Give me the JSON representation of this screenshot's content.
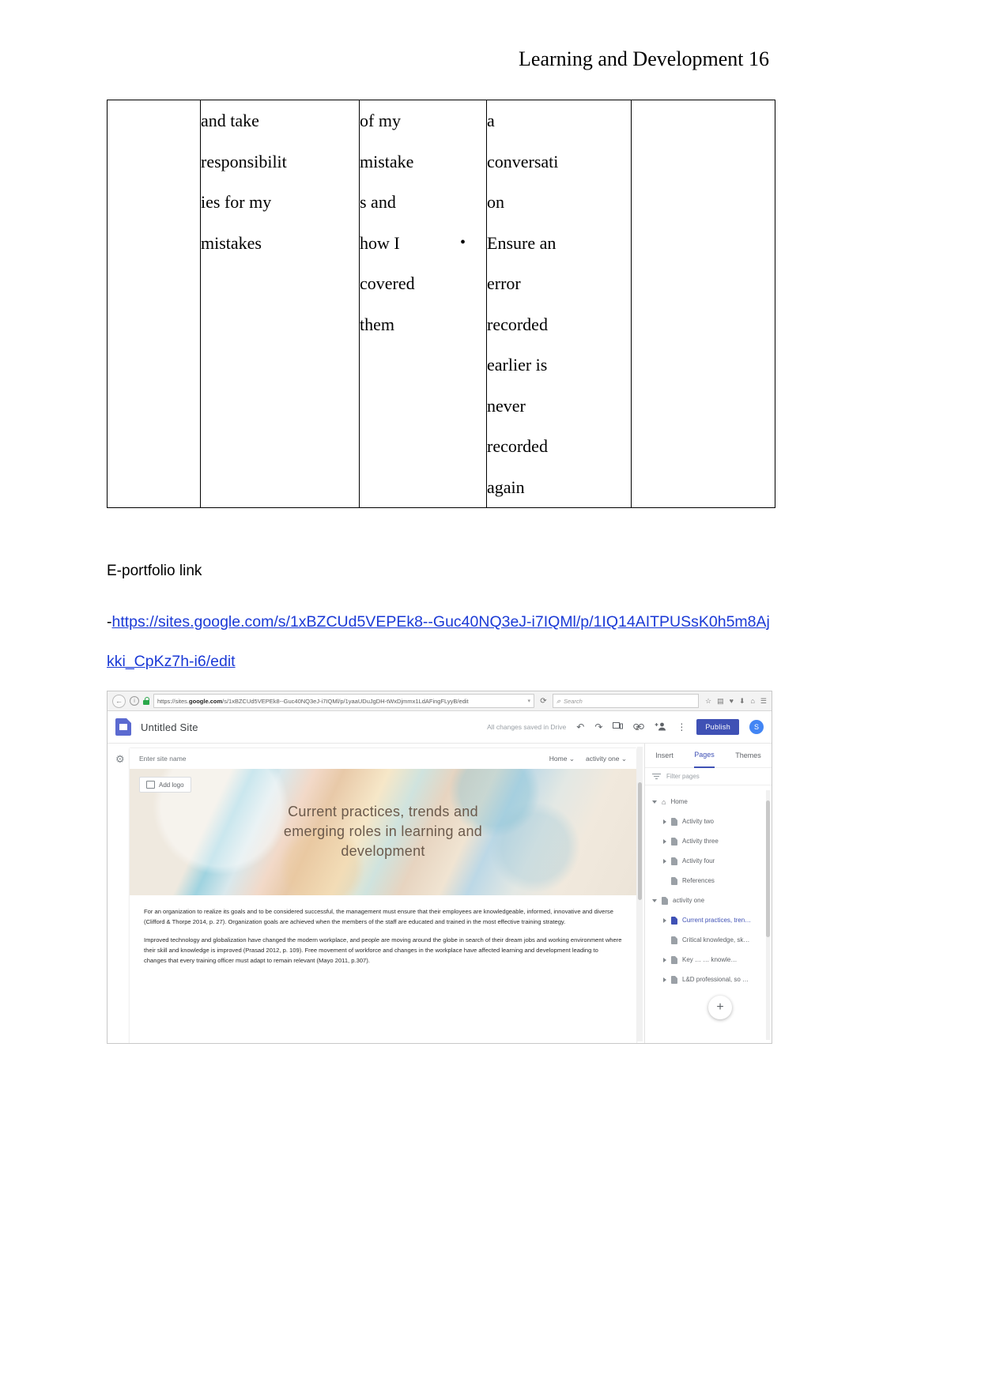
{
  "document": {
    "header": "Learning and Development 16"
  },
  "table": {
    "columns": [
      "",
      "",
      "",
      "",
      ""
    ],
    "rows": [
      {
        "c1": "",
        "c2": [
          "and take",
          "responsibilit",
          "ies for my",
          "mistakes"
        ],
        "c3": [
          "of my",
          "mistake",
          "s and",
          "how I",
          "covered",
          "them"
        ],
        "c4_plain": [
          "a",
          "conversati",
          "on"
        ],
        "c4_bullet_marker": "•",
        "c4_bullet": [
          "Ensure an",
          "error",
          "recorded",
          "earlier is",
          "never",
          "recorded",
          "again"
        ],
        "c5": ""
      }
    ]
  },
  "eportfolio": {
    "label": "E-portfolio link",
    "dash": "-",
    "url_line1": "https://sites.google.com/s/1xBZCUd5VEPEk8--Guc40NQ3eJ-i7IQMl/p/1IQ14AITPUSsK0h5m8Ajkki_C",
    "url_line2": "pKz7h-i6/edit"
  },
  "browser": {
    "back_icon": "←",
    "info_icon": "i",
    "lock_icon": "lock",
    "url_prefix": "https://sites.",
    "url_domain": "google.com",
    "url_suffix": "/s/1xBZCUd5VEPEk8--Guc40NQ3eJ-i7IQMl/p/1yaaUDuJgDH-tWxDjmmx1LdAFingFLyyB/edit",
    "url_caret": "▾",
    "reload_icon": "⟳",
    "search_placeholder": "Search",
    "search_icon": "⌕",
    "toolbar_icons": [
      "☆",
      "▤",
      "♥",
      "⬇",
      "⌂",
      "☰"
    ]
  },
  "sites_app": {
    "logo_name": "google-sites-logo",
    "site_title": "Untitled Site",
    "save_status": "All changes saved in Drive",
    "undo_icon": "↶",
    "redo_icon": "↷",
    "preview_icon": "preview",
    "link_icon": "🔗",
    "share_icon": "share",
    "more_icon": "⋮",
    "publish_label": "Publish",
    "avatar_initial": "S",
    "gear_icon": "⚙"
  },
  "site_canvas": {
    "site_name_placeholder": "Enter site name",
    "nav": [
      "Home",
      "activity one"
    ],
    "nav_caret": "⌄",
    "add_logo_label": "Add logo",
    "hero_title_lines": [
      "Current practices, trends and",
      "emerging roles in learning and",
      "development"
    ],
    "paragraphs": [
      "For an organization to realize its goals and to be considered successful, the management must ensure that their employees are knowledgeable, informed, innovative and diverse (Clifford & Thorpe 2014, p. 27). Organization goals are achieved when the members of the staff are educated and trained in the most effective training strategy.",
      "Improved technology and globalization have changed the modern workplace, and people are moving around the globe in search of their dream jobs and working environment where their skill and knowledge is improved (Prasad 2012, p. 109). Free movement of workforce and changes in the workplace have affected learning and development leading to changes that every training officer must adapt to remain relevant (Mayo 2011, p.307)."
    ]
  },
  "side_panel": {
    "tabs": [
      {
        "label": "Insert",
        "active": false
      },
      {
        "label": "Pages",
        "active": true
      },
      {
        "label": "Themes",
        "active": false
      }
    ],
    "filter_placeholder": "Filter pages",
    "filter_icon": "filter-icon",
    "tree": [
      {
        "label": "Home",
        "icon": "home-icon",
        "expanded": true,
        "indent": false,
        "selected": false
      },
      {
        "label": "Activity two",
        "icon": "page-icon",
        "expanded": false,
        "indent": true,
        "selected": false
      },
      {
        "label": "Activity three",
        "icon": "page-icon",
        "expanded": false,
        "indent": true,
        "selected": false
      },
      {
        "label": "Activity four",
        "icon": "page-icon",
        "expanded": false,
        "indent": true,
        "selected": false
      },
      {
        "label": "References",
        "icon": "page-icon",
        "expanded": null,
        "indent": true,
        "selected": false
      },
      {
        "label": "activity one",
        "icon": "page-icon",
        "expanded": true,
        "indent": false,
        "selected": false
      },
      {
        "label": "Current practices, tren…",
        "icon": "page-icon",
        "expanded": false,
        "indent": true,
        "selected": true
      },
      {
        "label": "Critical knowledge, sk…",
        "icon": "page-icon",
        "expanded": null,
        "indent": true,
        "selected": false
      },
      {
        "label": "Key …    … knowle…",
        "icon": "page-icon",
        "expanded": false,
        "indent": true,
        "selected": false
      },
      {
        "label": "L&D professional, so  …",
        "icon": "page-icon",
        "expanded": false,
        "indent": true,
        "selected": false
      }
    ],
    "fab_icon": "+"
  }
}
